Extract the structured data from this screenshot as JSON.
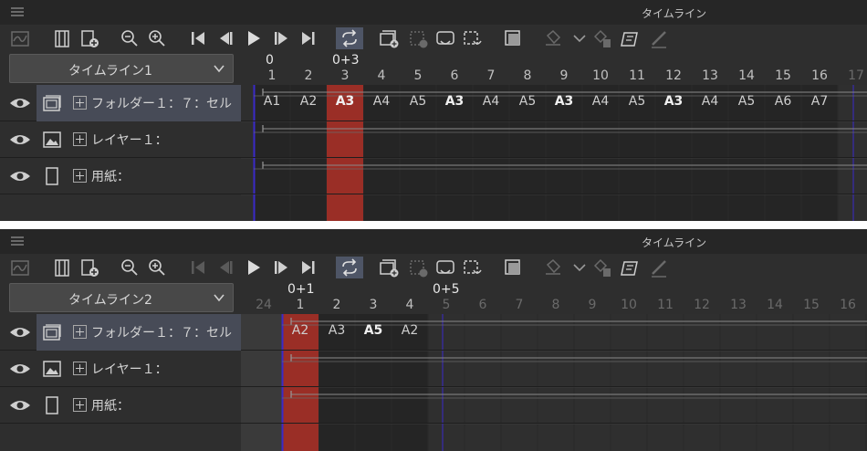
{
  "panel1": {
    "title": "タイムライン",
    "timeline_name": "タイムライン1",
    "current_frame_top": "0+3",
    "origin_top": "0",
    "ruler": [
      "1",
      "2",
      "3",
      "4",
      "5",
      "6",
      "7",
      "8",
      "9",
      "10",
      "11",
      "12",
      "13",
      "14",
      "15",
      "16",
      "17"
    ],
    "cells": [
      "A1",
      "A2",
      "A3",
      "A4",
      "A5",
      "A3",
      "A4",
      "A5",
      "A3",
      "A4",
      "A5",
      "A3",
      "A4",
      "A5",
      "A6",
      "A7"
    ],
    "bold_cells": [
      2,
      5,
      8,
      11
    ]
  },
  "panel2": {
    "title": "タイムライン",
    "timeline_name": "タイムライン2",
    "current_frame_top": "0+1",
    "end_frame_top": "0+5",
    "ruler_prev": "24",
    "ruler": [
      "1",
      "2",
      "3",
      "4",
      "5",
      "6",
      "7",
      "8",
      "9",
      "10",
      "11",
      "12",
      "13",
      "14",
      "15",
      "16"
    ],
    "cells": [
      "A2",
      "A3",
      "A5",
      "A2"
    ],
    "bold_cells": [
      2
    ]
  },
  "layers": [
    {
      "name": "フォルダー１：７：セル",
      "icon": "folder-layer-icon",
      "selected": true
    },
    {
      "name": "レイヤー１：",
      "icon": "image-layer-icon",
      "selected": false
    },
    {
      "name": "用紙：",
      "icon": "paper-layer-icon",
      "selected": false
    }
  ],
  "toolbar_icons": [
    "timeline-graph-icon",
    "frame-strip-icon",
    "new-frame-icon",
    "zoom-out-icon",
    "zoom-in-icon",
    "first-frame-icon",
    "prev-frame-icon",
    "play-icon",
    "next-frame-icon",
    "last-frame-icon",
    "loop-icon",
    "new-animation-folder-icon",
    "new-cel-icon",
    "cel-spec-icon",
    "cel-replace-icon",
    "onion-skin-icon",
    "link-icon",
    "dropdown-icon",
    "delete-cel-icon",
    "cel-note-icon",
    "edit-pencil-icon"
  ],
  "colors": {
    "playhead": "#9a2e26",
    "range_marker": "#2a1aa8",
    "selected_layer": "#474b57",
    "panel_bg": "#2e2e2e"
  }
}
